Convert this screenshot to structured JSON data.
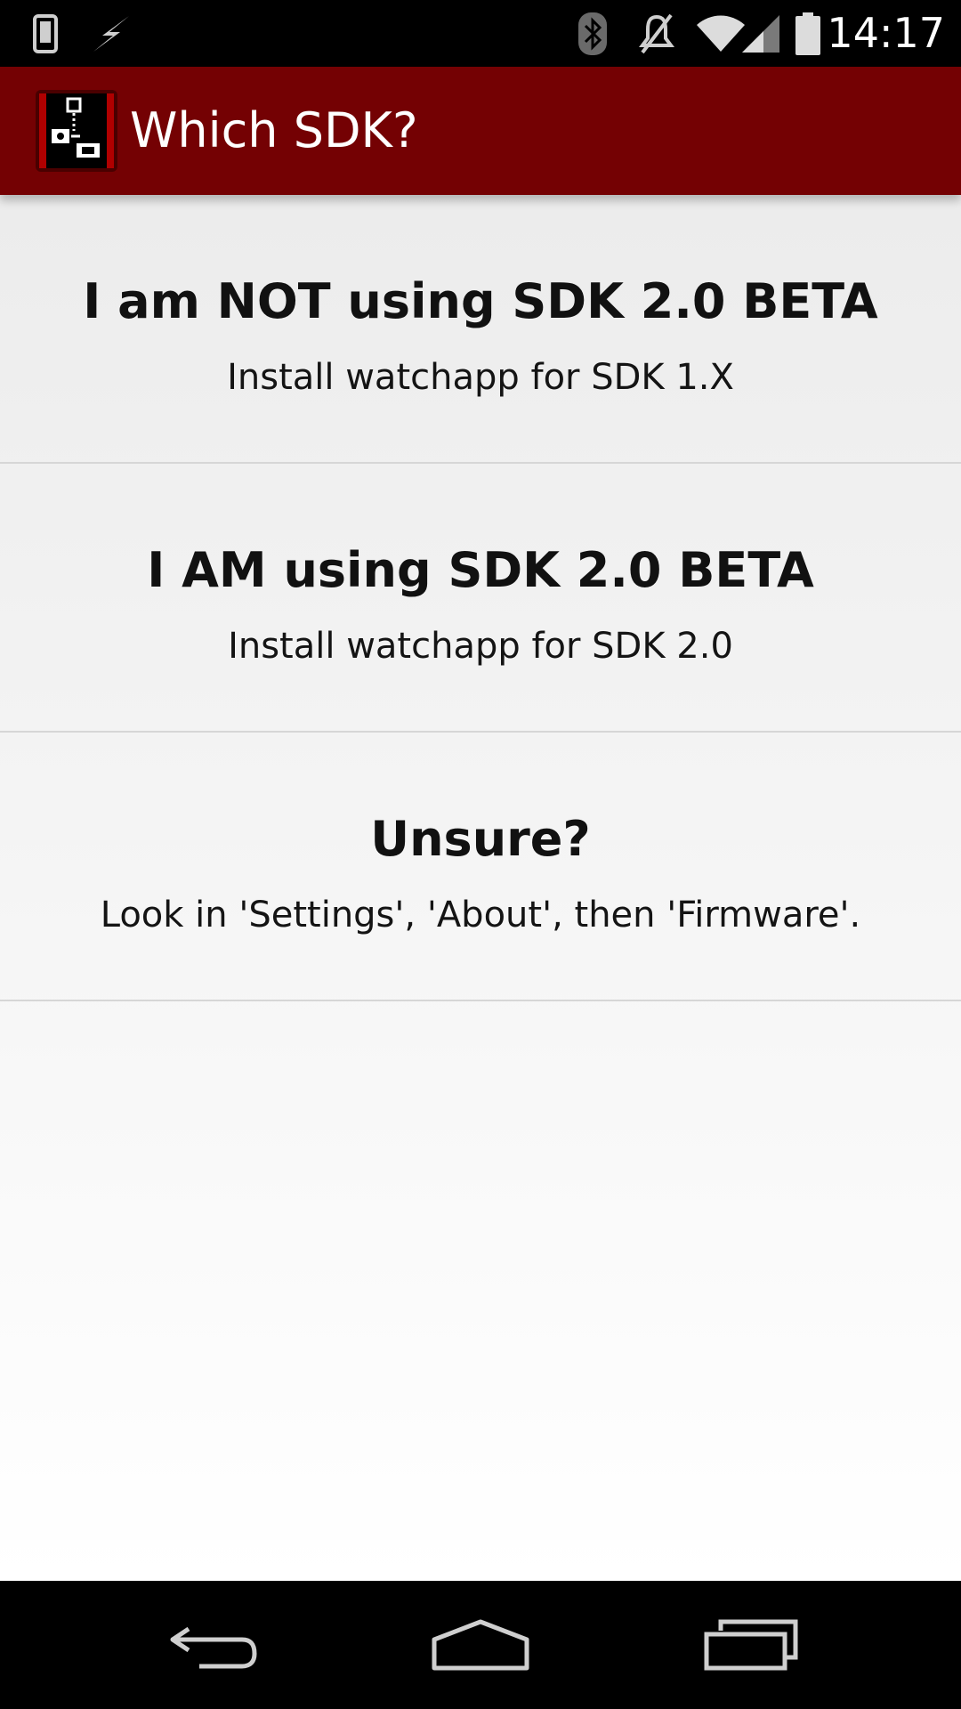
{
  "status_bar": {
    "time": "14:17",
    "left_icons": [
      "phone-icon",
      "lightning-icon"
    ],
    "right_icons": [
      "bluetooth-icon",
      "mute-icon",
      "wifi-icon",
      "cell-signal-icon",
      "battery-icon"
    ]
  },
  "action_bar": {
    "title": "Which SDK?",
    "background_color": "#740103"
  },
  "options": [
    {
      "title": "I am NOT using SDK 2.0 BETA",
      "subtitle": "Install watchapp for SDK 1.X"
    },
    {
      "title": "I AM using SDK 2.0 BETA",
      "subtitle": "Install watchapp for SDK 2.0"
    },
    {
      "title": "Unsure?",
      "subtitle": "Look in 'Settings', 'About', then 'Firmware'."
    }
  ],
  "nav_bar": {
    "buttons": [
      "back-icon",
      "home-icon",
      "recents-icon"
    ]
  }
}
